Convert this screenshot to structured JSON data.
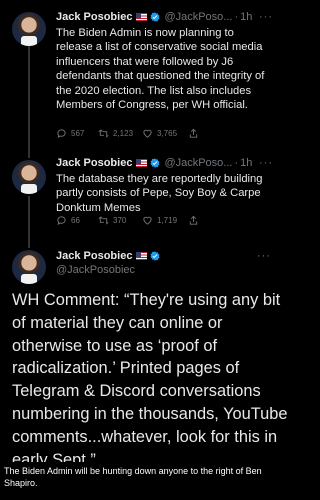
{
  "author": {
    "name": "Jack Posobiec",
    "handle_short": "@JackPoso...",
    "handle_full": "@JackPosobiec"
  },
  "tweets": [
    {
      "handle": "@JackPoso...",
      "time": "1h",
      "lines": [
        "The Biden Admin is now planning to",
        "release a list of conservative social media",
        "influencers that were followed by J6",
        "defendants that questioned the integrity of",
        "the 2020 election. The list also includes",
        "Members of Congress, per WH official."
      ],
      "replies": "567",
      "retweets": "2,123",
      "likes": "3,765"
    },
    {
      "handle": "@JackPoso...",
      "time": "1h",
      "lines": [
        "The database they are reportedly building",
        "partly consists of Pepe, Soy Boy & Carpe",
        "Donktum Memes"
      ],
      "replies": "66",
      "retweets": "370",
      "likes": "1,719"
    }
  ],
  "main_tweet": {
    "lines": [
      "WH Comment: “They're using any bit",
      "of material they can online or",
      "otherwise to use as ‘proof of",
      "radicalization.’ Printed pages of",
      "Telegram & Discord conversations",
      "numbering in the thousands, YouTube",
      "comments...whatever, look for this in",
      "early Sept.”"
    ]
  },
  "caption": "The Biden Admin will be hunting down anyone to the right of Ben Shapiro.",
  "glyphs": {
    "dot": "·",
    "more": "···"
  },
  "colors": {
    "background": "#000000",
    "text": "#e7e9ea",
    "muted": "#71767b",
    "verified": "#1d9bf0"
  }
}
